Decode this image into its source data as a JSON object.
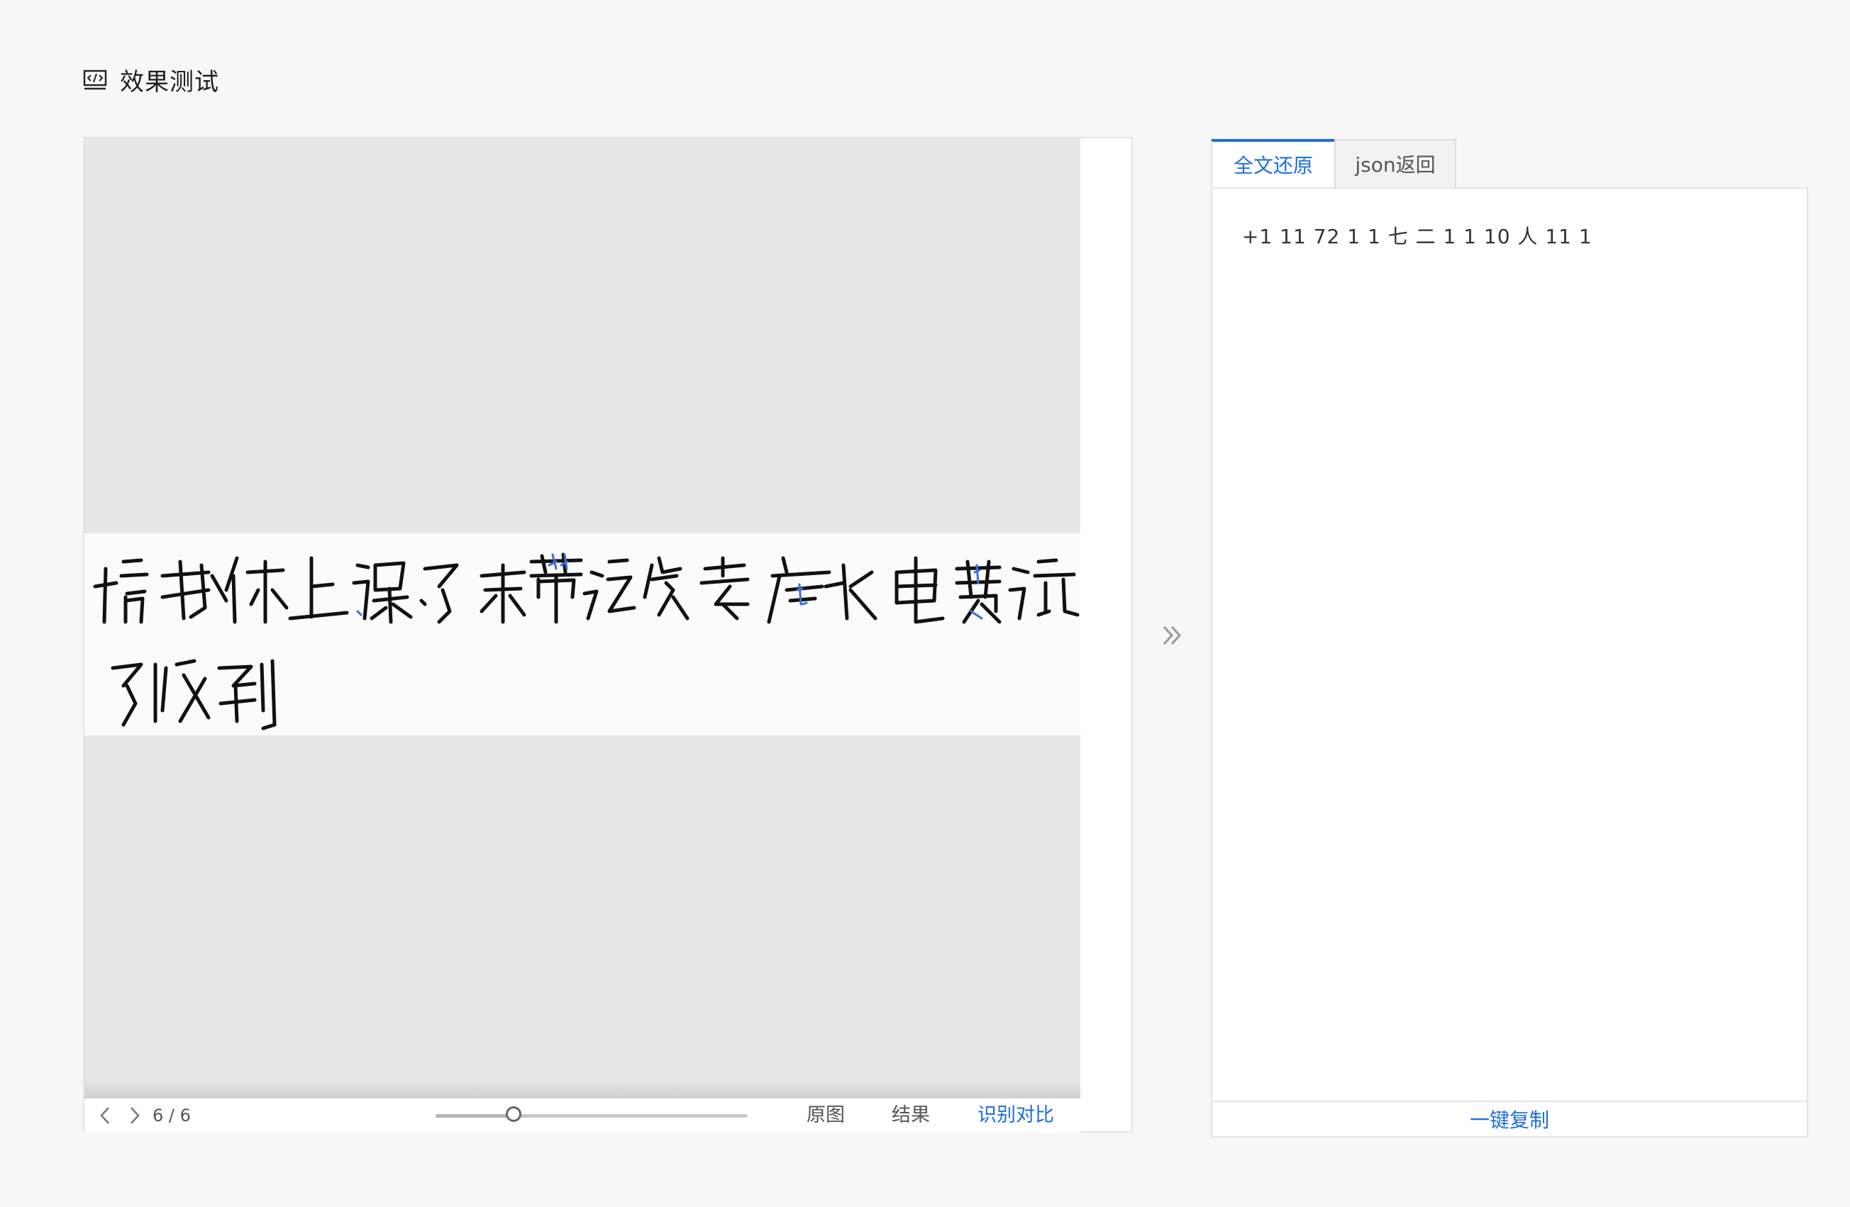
{
  "header": {
    "title": "效果测试",
    "icon": "code-icon"
  },
  "viewer": {
    "page_indicator": "6 / 6",
    "current_page": 6,
    "total_pages": 6,
    "zoom_fraction": 0.25,
    "prev_icon": "chevron-left-icon",
    "next_icon": "chevron-right-icon",
    "modes": {
      "original": "原图",
      "result": "结果",
      "compare": "识别对比"
    },
    "active_mode": "compare"
  },
  "tabs": {
    "fulltext": "全文还原",
    "json": "json返回",
    "active": "fulltext"
  },
  "result": {
    "text": "+1 11 72 1 1 七 二 1 1 10 人 11 1",
    "copy_label": "一键复制"
  },
  "colors": {
    "accent": "#1d6de0",
    "background": "#f7f7f7",
    "viewer_bg": "#e6e6e6"
  }
}
